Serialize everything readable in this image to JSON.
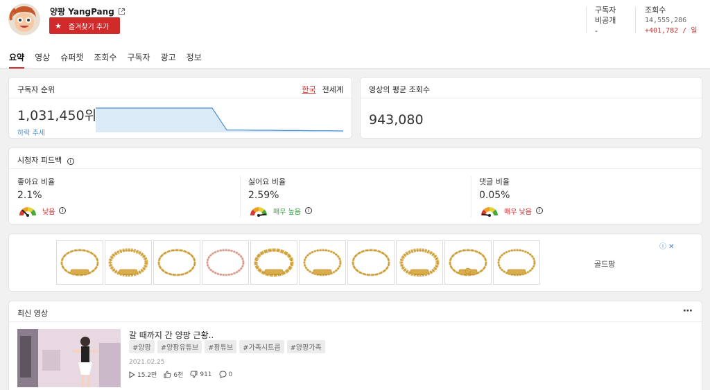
{
  "channel": {
    "name": "양팡 YangPang",
    "favorite_label": "즐겨찾기 추가"
  },
  "header_stats": {
    "subscribers_label": "구독자",
    "subscribers_value": "비공개",
    "subscribers_sub": "-",
    "views_label": "조회수",
    "views_value": "14,555,286",
    "views_delta": "+401,782 / 일"
  },
  "tabs": [
    {
      "label": "요약",
      "active": true
    },
    {
      "label": "영상"
    },
    {
      "label": "슈퍼챗"
    },
    {
      "label": "조회수"
    },
    {
      "label": "구독자"
    },
    {
      "label": "광고"
    },
    {
      "label": "정보"
    }
  ],
  "rank_card": {
    "title": "구독자 순위",
    "toggle_korea": "한국",
    "toggle_world": "전세계",
    "value": "1,031,450위",
    "trend": "하락 추세",
    "sparkline": [
      0.0,
      0.0,
      0.0,
      0.0,
      0.0,
      0.0,
      0.0,
      0.0,
      0.0,
      0.96,
      0.96,
      0.97,
      0.97,
      0.98,
      0.98,
      0.99,
      0.99,
      1.0
    ]
  },
  "avg_card": {
    "title": "영상의 평균 조회수",
    "value": "943,080"
  },
  "feedback": {
    "title": "시청자 피드백",
    "items": [
      {
        "label": "좋아요 비율",
        "value": "2.1%",
        "rating": "낮음",
        "tone": "red",
        "level": 0.25
      },
      {
        "label": "싫어요 비율",
        "value": "2.59%",
        "rating": "매우 높음",
        "tone": "green",
        "level": 0.95
      },
      {
        "label": "댓글 비율",
        "value": "0.05%",
        "rating": "매우 낮음",
        "tone": "red",
        "level": 0.05
      }
    ]
  },
  "ad": {
    "brand": "골드팡",
    "tile_count": 10
  },
  "latest": {
    "title": "최신 영상",
    "video": {
      "title": "갈 때까지 간 양팡 근황..",
      "hashtags": [
        "#양팡",
        "#양팡유튜브",
        "#팡튜브",
        "#가족시트콤",
        "#양팡가족"
      ],
      "date": "2021.02.25",
      "views": "15.2만",
      "likes": "6천",
      "dislikes": "911",
      "comments": "0"
    }
  },
  "colors": {
    "accent": "#d12a2a",
    "link": "#4a8fd1",
    "good": "#2f9a3a"
  }
}
